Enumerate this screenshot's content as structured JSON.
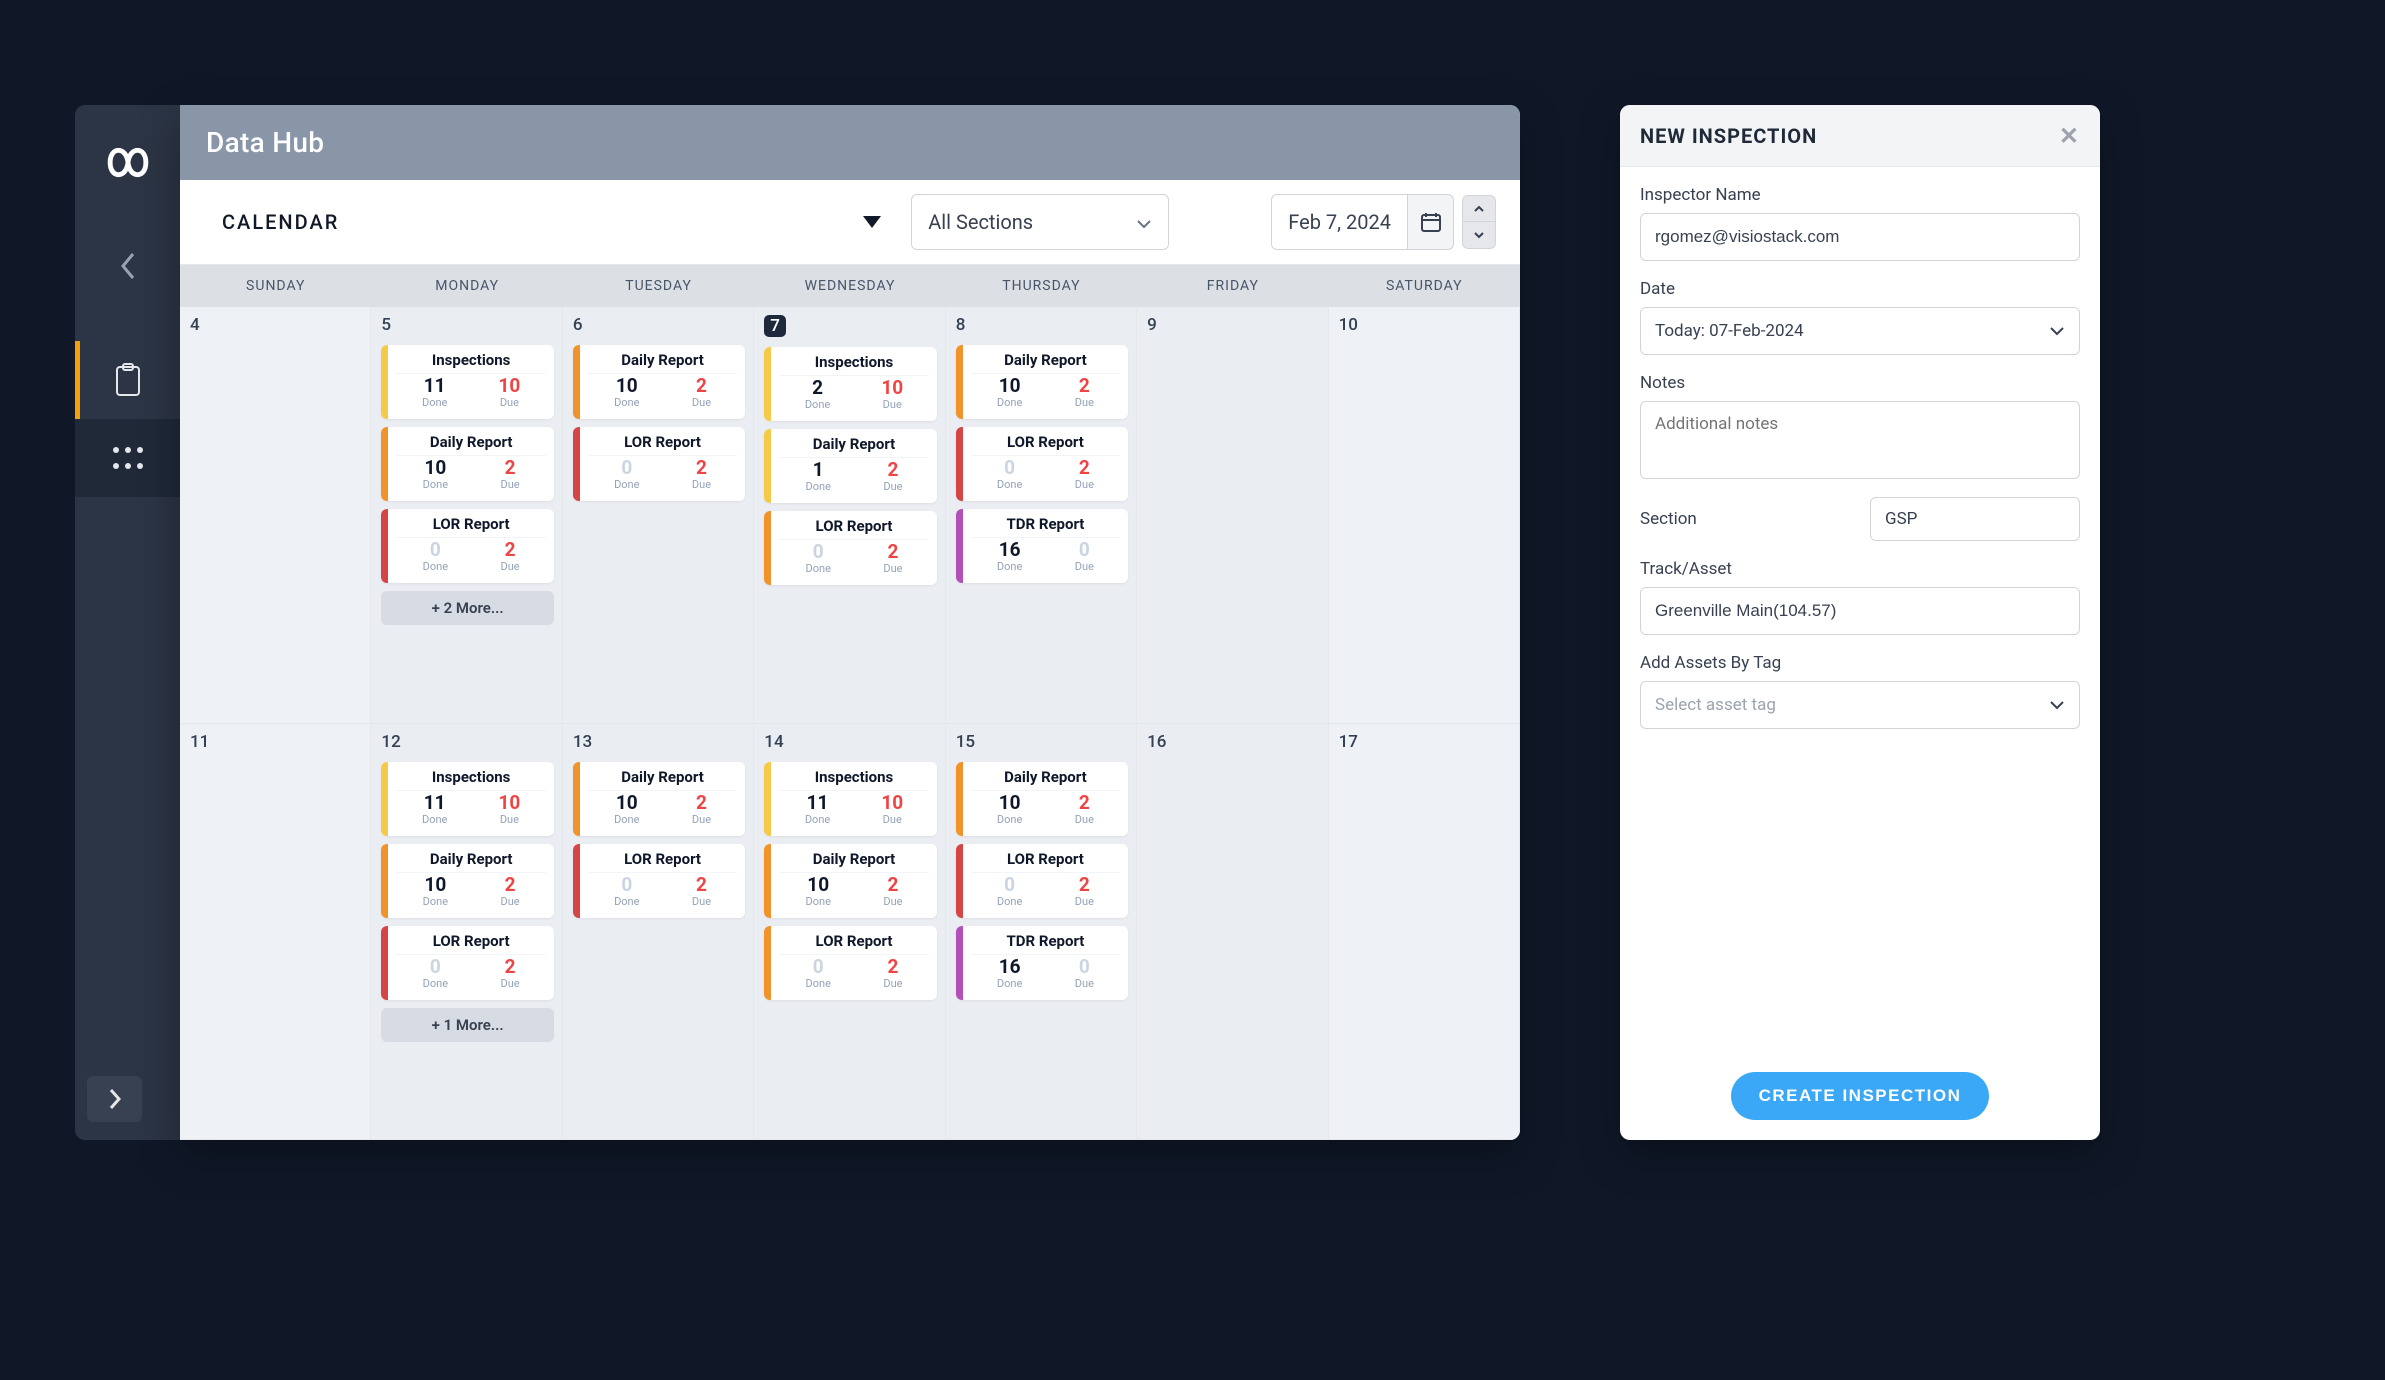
{
  "app": {
    "title": "Data Hub"
  },
  "sidebar": {
    "items": [
      {
        "name": "clipboard",
        "active": true
      },
      {
        "name": "apps-grid",
        "active": false
      }
    ]
  },
  "toolbar": {
    "view_label": "CALENDAR",
    "section_label": "All Sections",
    "date_label": "Feb 7, 2024"
  },
  "weekdays": [
    "SUNDAY",
    "MONDAY",
    "TUESDAY",
    "WEDNESDAY",
    "THURSDAY",
    "FRIDAY",
    "SATURDAY"
  ],
  "col_labels": {
    "done": "Done",
    "due": "Due"
  },
  "weeks": [
    [
      {
        "num": "4",
        "workday": false,
        "cards": []
      },
      {
        "num": "5",
        "workday": true,
        "cards": [
          {
            "title": "Inspections",
            "done": 11,
            "due": 10,
            "accent": "yellow"
          },
          {
            "title": "Daily Report",
            "done": 10,
            "due": 2,
            "accent": "orange"
          },
          {
            "title": "LOR Report",
            "done": 0,
            "due": 2,
            "accent": "red"
          }
        ],
        "more": "+ 2 More..."
      },
      {
        "num": "6",
        "workday": true,
        "cards": [
          {
            "title": "Daily Report",
            "done": 10,
            "due": 2,
            "accent": "orange"
          },
          {
            "title": "LOR Report",
            "done": 0,
            "due": 2,
            "accent": "red"
          }
        ]
      },
      {
        "num": "7",
        "workday": true,
        "today": true,
        "cards": [
          {
            "title": "Inspections",
            "done": 2,
            "due": 10,
            "accent": "yellow"
          },
          {
            "title": "Daily Report",
            "done": 1,
            "due": 2,
            "accent": "yellow"
          },
          {
            "title": "LOR Report",
            "done": 0,
            "due": 2,
            "accent": "orange"
          }
        ]
      },
      {
        "num": "8",
        "workday": true,
        "cards": [
          {
            "title": "Daily Report",
            "done": 10,
            "due": 2,
            "accent": "orange"
          },
          {
            "title": "LOR Report",
            "done": 0,
            "due": 2,
            "accent": "red"
          },
          {
            "title": "TDR Report",
            "done": 16,
            "due": 0,
            "accent": "purple"
          }
        ]
      },
      {
        "num": "9",
        "workday": true,
        "cards": []
      },
      {
        "num": "10",
        "workday": false,
        "cards": []
      }
    ],
    [
      {
        "num": "11",
        "workday": false,
        "cards": []
      },
      {
        "num": "12",
        "workday": true,
        "cards": [
          {
            "title": "Inspections",
            "done": 11,
            "due": 10,
            "accent": "yellow"
          },
          {
            "title": "Daily Report",
            "done": 10,
            "due": 2,
            "accent": "orange"
          },
          {
            "title": "LOR Report",
            "done": 0,
            "due": 2,
            "accent": "red"
          }
        ],
        "more": "+ 1 More..."
      },
      {
        "num": "13",
        "workday": true,
        "cards": [
          {
            "title": "Daily Report",
            "done": 10,
            "due": 2,
            "accent": "orange"
          },
          {
            "title": "LOR Report",
            "done": 0,
            "due": 2,
            "accent": "red"
          }
        ]
      },
      {
        "num": "14",
        "workday": true,
        "cards": [
          {
            "title": "Inspections",
            "done": 11,
            "due": 10,
            "accent": "yellow"
          },
          {
            "title": "Daily Report",
            "done": 10,
            "due": 2,
            "accent": "orange"
          },
          {
            "title": "LOR Report",
            "done": 0,
            "due": 2,
            "accent": "orange"
          }
        ]
      },
      {
        "num": "15",
        "workday": true,
        "cards": [
          {
            "title": "Daily Report",
            "done": 10,
            "due": 2,
            "accent": "orange"
          },
          {
            "title": "LOR Report",
            "done": 0,
            "due": 2,
            "accent": "red"
          },
          {
            "title": "TDR Report",
            "done": 16,
            "due": 0,
            "accent": "purple"
          }
        ]
      },
      {
        "num": "16",
        "workday": true,
        "cards": []
      },
      {
        "num": "17",
        "workday": false,
        "cards": []
      }
    ]
  ],
  "panel": {
    "title": "NEW INSPECTION",
    "fields": {
      "inspector_label": "Inspector Name",
      "inspector_value": "rgomez@visiostack.com",
      "date_label": "Date",
      "date_value": "Today: 07-Feb-2024",
      "notes_label": "Notes",
      "notes_placeholder": "Additional notes",
      "section_label": "Section",
      "section_value": "GSP",
      "track_label": "Track/Asset",
      "track_value": "Greenville Main(104.57)",
      "tag_label": "Add Assets By Tag",
      "tag_placeholder": "Select asset tag"
    },
    "create_label": "CREATE INSPECTION"
  }
}
